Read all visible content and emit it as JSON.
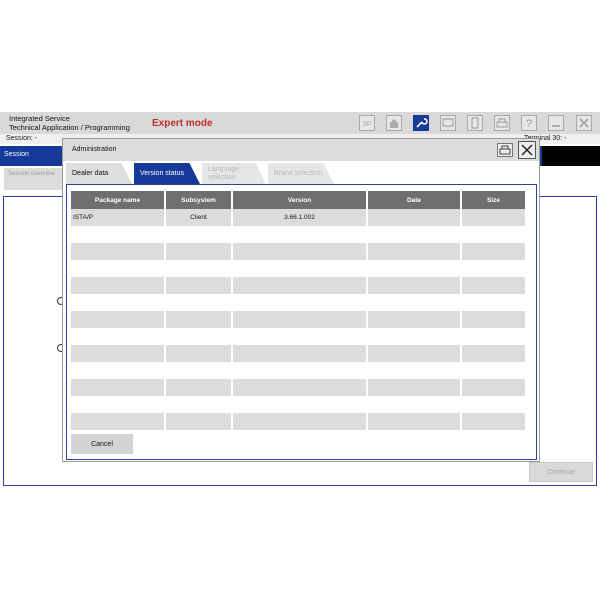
{
  "app": {
    "title_line1": "Integrated Service",
    "title_line2": "Technical Application / Programming",
    "mode": "Expert mode",
    "session_label": "Session:  -",
    "terminal_label": "Terminal 30:  -",
    "session_bar_label": "Session",
    "session_overview_tab": "Session overview",
    "continue_button": "Continue",
    "toolbar_xp": "XP"
  },
  "dialog": {
    "title": "Administration",
    "tabs": [
      {
        "label": "Dealer data",
        "state": "inactive"
      },
      {
        "label": "Version status",
        "state": "active"
      },
      {
        "label": "Language selection",
        "state": "disabled"
      },
      {
        "label": "Brand selection",
        "state": "disabled"
      }
    ],
    "table": {
      "columns": [
        "Package name",
        "Subsystem",
        "Version",
        "Date",
        "Size"
      ],
      "rows": [
        [
          "ISTA/P",
          "Client",
          "3.66.1.002",
          "",
          ""
        ]
      ]
    },
    "cancel_button": "Cancel"
  },
  "colors": {
    "accent_blue": "#163a99",
    "header_gray": "#6f6f6f",
    "mode_red": "#c0302a"
  }
}
